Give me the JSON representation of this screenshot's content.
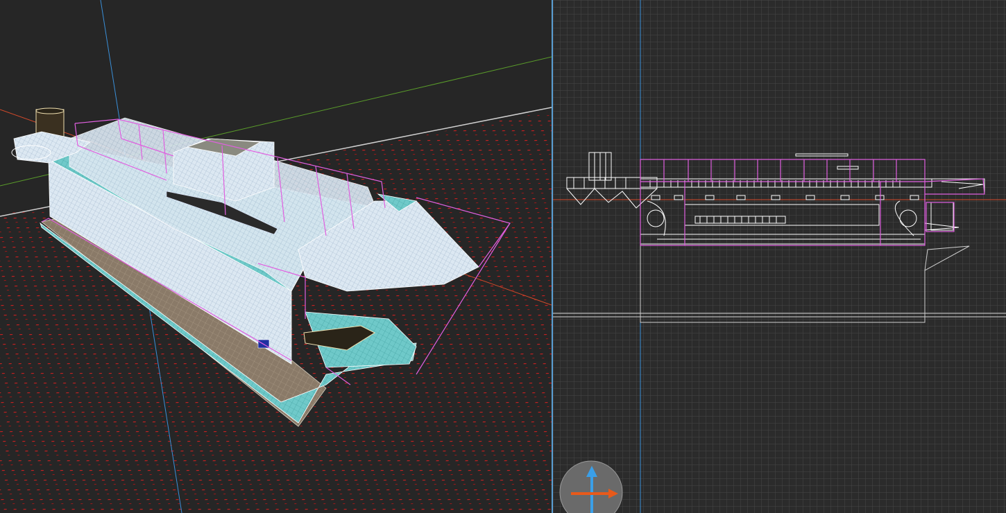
{
  "colors": {
    "background_persp": "#262626",
    "background_ortho": "#2b2b2b",
    "viewport_border": "#5a9fd4",
    "axis_x": "#d44a2a",
    "axis_y": "#5a9c2a",
    "axis_z": "#3a8fd8",
    "selection": "#e060e0",
    "hull_light": "#dce8f2",
    "hull_teal": "#6fc9c9",
    "hull_bottom": "#8a7a68",
    "wire": "#ffffff",
    "grid_ortho": "#4a4a4a",
    "grid_floor": "#c42020"
  },
  "viewports": {
    "perspective": {
      "icon": "ship-model-3d"
    },
    "top": {
      "icon": "ship-model-2d",
      "gizmo": "move-axis-icon"
    }
  }
}
